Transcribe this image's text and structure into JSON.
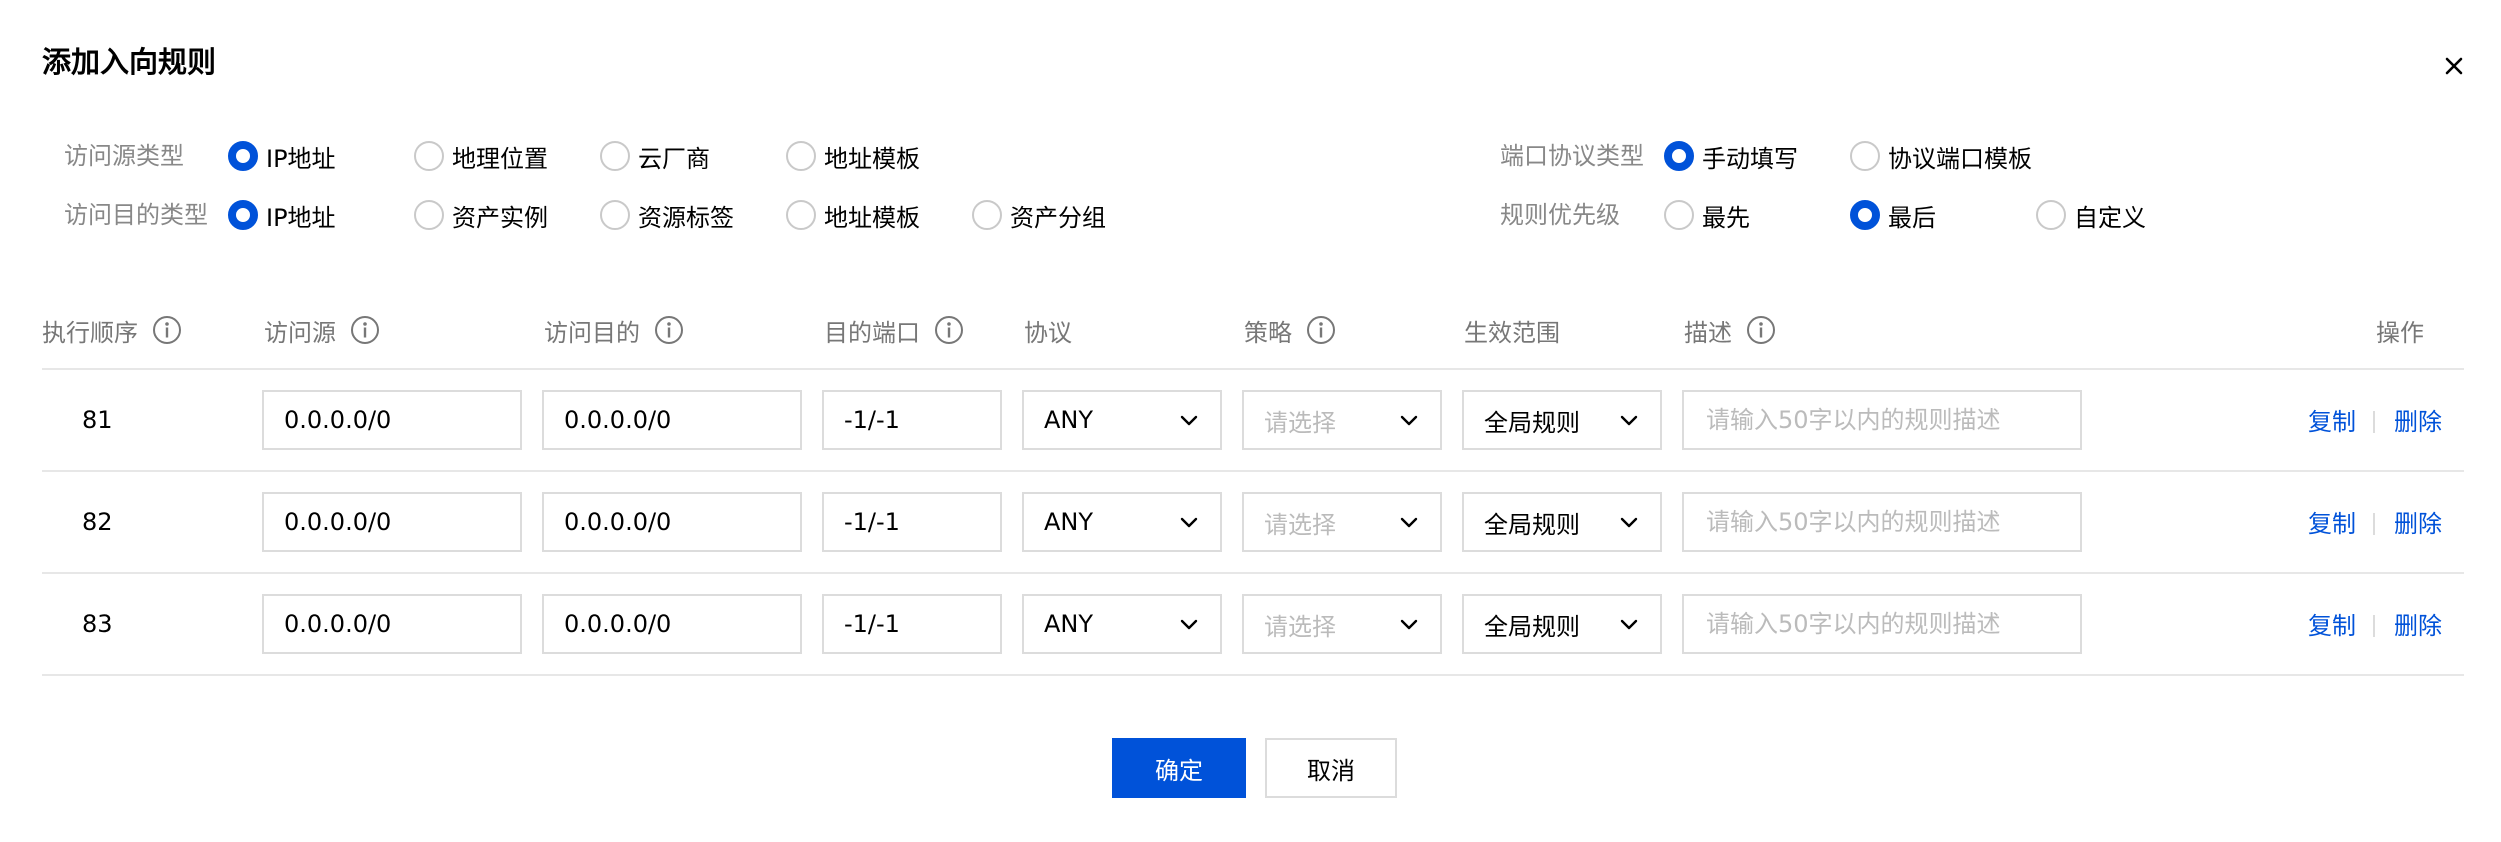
{
  "dialog": {
    "title": "添加入向规则",
    "close_icon": "close-icon"
  },
  "options": {
    "source_type": {
      "label": "访问源类型",
      "choices": [
        "IP地址",
        "地理位置",
        "云厂商",
        "地址模板"
      ],
      "selected": "IP地址"
    },
    "dest_type": {
      "label": "访问目的类型",
      "choices": [
        "IP地址",
        "资产实例",
        "资源标签",
        "地址模板",
        "资产分组"
      ],
      "selected": "IP地址"
    },
    "port_protocol_type": {
      "label": "端口协议类型",
      "choices": [
        "手动填写",
        "协议端口模板"
      ],
      "selected": "手动填写"
    },
    "priority": {
      "label": "规则优先级",
      "choices": [
        "最先",
        "最后",
        "自定义"
      ],
      "selected": "最后"
    }
  },
  "table": {
    "headers": {
      "order": "执行顺序",
      "source": "访问源",
      "dest": "访问目的",
      "port": "目的端口",
      "protocol": "协议",
      "policy": "策略",
      "scope": "生效范围",
      "desc": "描述",
      "ops": "操作"
    },
    "rows": [
      {
        "order": "81",
        "source": "0.0.0.0/0",
        "dest": "0.0.0.0/0",
        "port": "-1/-1",
        "protocol": "ANY",
        "policy": "请选择",
        "scope": "全局规则",
        "desc_placeholder": "请输入50字以内的规则描述",
        "copy": "复制",
        "delete": "删除"
      },
      {
        "order": "82",
        "source": "0.0.0.0/0",
        "dest": "0.0.0.0/0",
        "port": "-1/-1",
        "protocol": "ANY",
        "policy": "请选择",
        "scope": "全局规则",
        "desc_placeholder": "请输入50字以内的规则描述",
        "copy": "复制",
        "delete": "删除"
      },
      {
        "order": "83",
        "source": "0.0.0.0/0",
        "dest": "0.0.0.0/0",
        "port": "-1/-1",
        "protocol": "ANY",
        "policy": "请选择",
        "scope": "全局规则",
        "desc_placeholder": "请输入50字以内的规则描述",
        "copy": "复制",
        "delete": "删除"
      }
    ]
  },
  "footer": {
    "confirm_label": "确定",
    "cancel_label": "取消"
  },
  "colors": {
    "primary": "#0052d9",
    "border": "#dcdcdc",
    "label_gray": "#888888",
    "placeholder": "#bbbbbb"
  }
}
